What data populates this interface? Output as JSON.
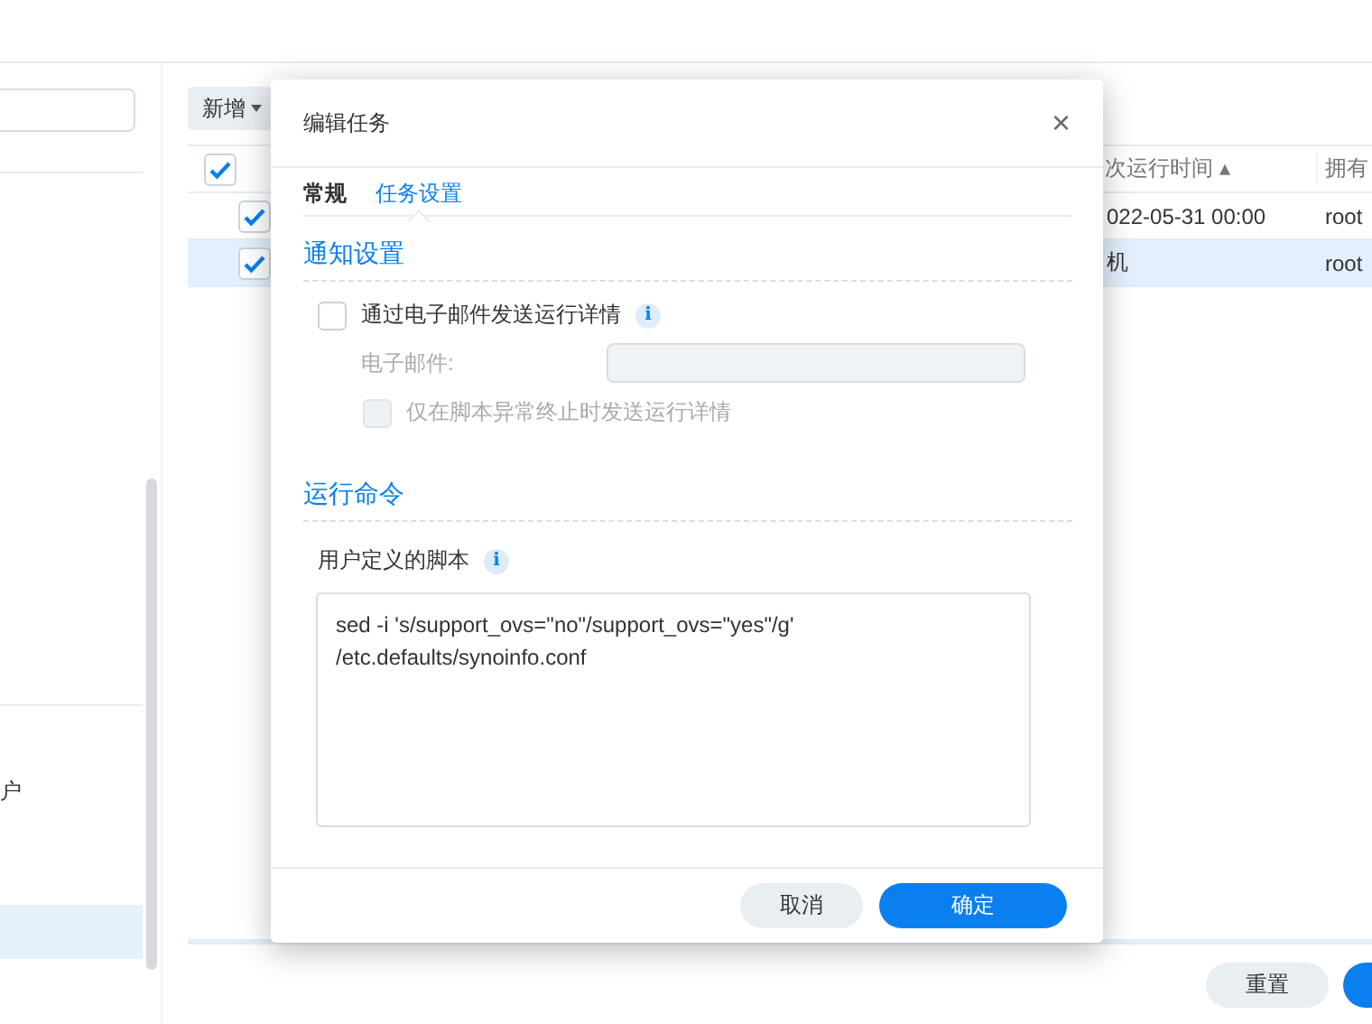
{
  "sidebar": {
    "items": [
      {
        "label": "户",
        "selected": false
      },
      {
        "selected": true
      }
    ]
  },
  "toolbar": {
    "add_button": "新增"
  },
  "table": {
    "header_checked": true,
    "columns": [
      "次运行时间",
      "拥有"
    ],
    "sort_icon": "▴",
    "rows": [
      {
        "checked": true,
        "selected": false,
        "cells": [
          "022-05-31 00:00",
          "root"
        ]
      },
      {
        "checked": true,
        "selected": true,
        "cells": [
          "机",
          "root"
        ]
      }
    ]
  },
  "footer_buttons": [
    {
      "label": "重置",
      "kind": "secondary"
    },
    {
      "kind": "primary"
    }
  ],
  "dialog": {
    "title": "编辑任务",
    "close": "×",
    "tabs": [
      {
        "label": "常规",
        "selected": false
      },
      {
        "label": "任务设置",
        "selected": true
      }
    ],
    "notify_section": "通知设置",
    "email_option": {
      "label": "通过电子邮件发送运行详情",
      "checked": false,
      "disabled": false,
      "info": "i"
    },
    "email_field": {
      "label": "电子邮件:",
      "disabled": true
    },
    "abnormal_option": {
      "label": "仅在脚本异常终止时发送运行详情",
      "checked": false,
      "disabled": true
    },
    "command_section": "运行命令",
    "script_label": "用户定义的脚本",
    "script_info": "i",
    "script": "sed -i 's/support_ovs=\"no\"/support_ovs=\"yes\"/g'\n/etc.defaults/synoinfo.conf",
    "buttons": [
      {
        "label": "取消",
        "kind": "secondary"
      },
      {
        "label": "确定",
        "kind": "primary"
      }
    ]
  }
}
